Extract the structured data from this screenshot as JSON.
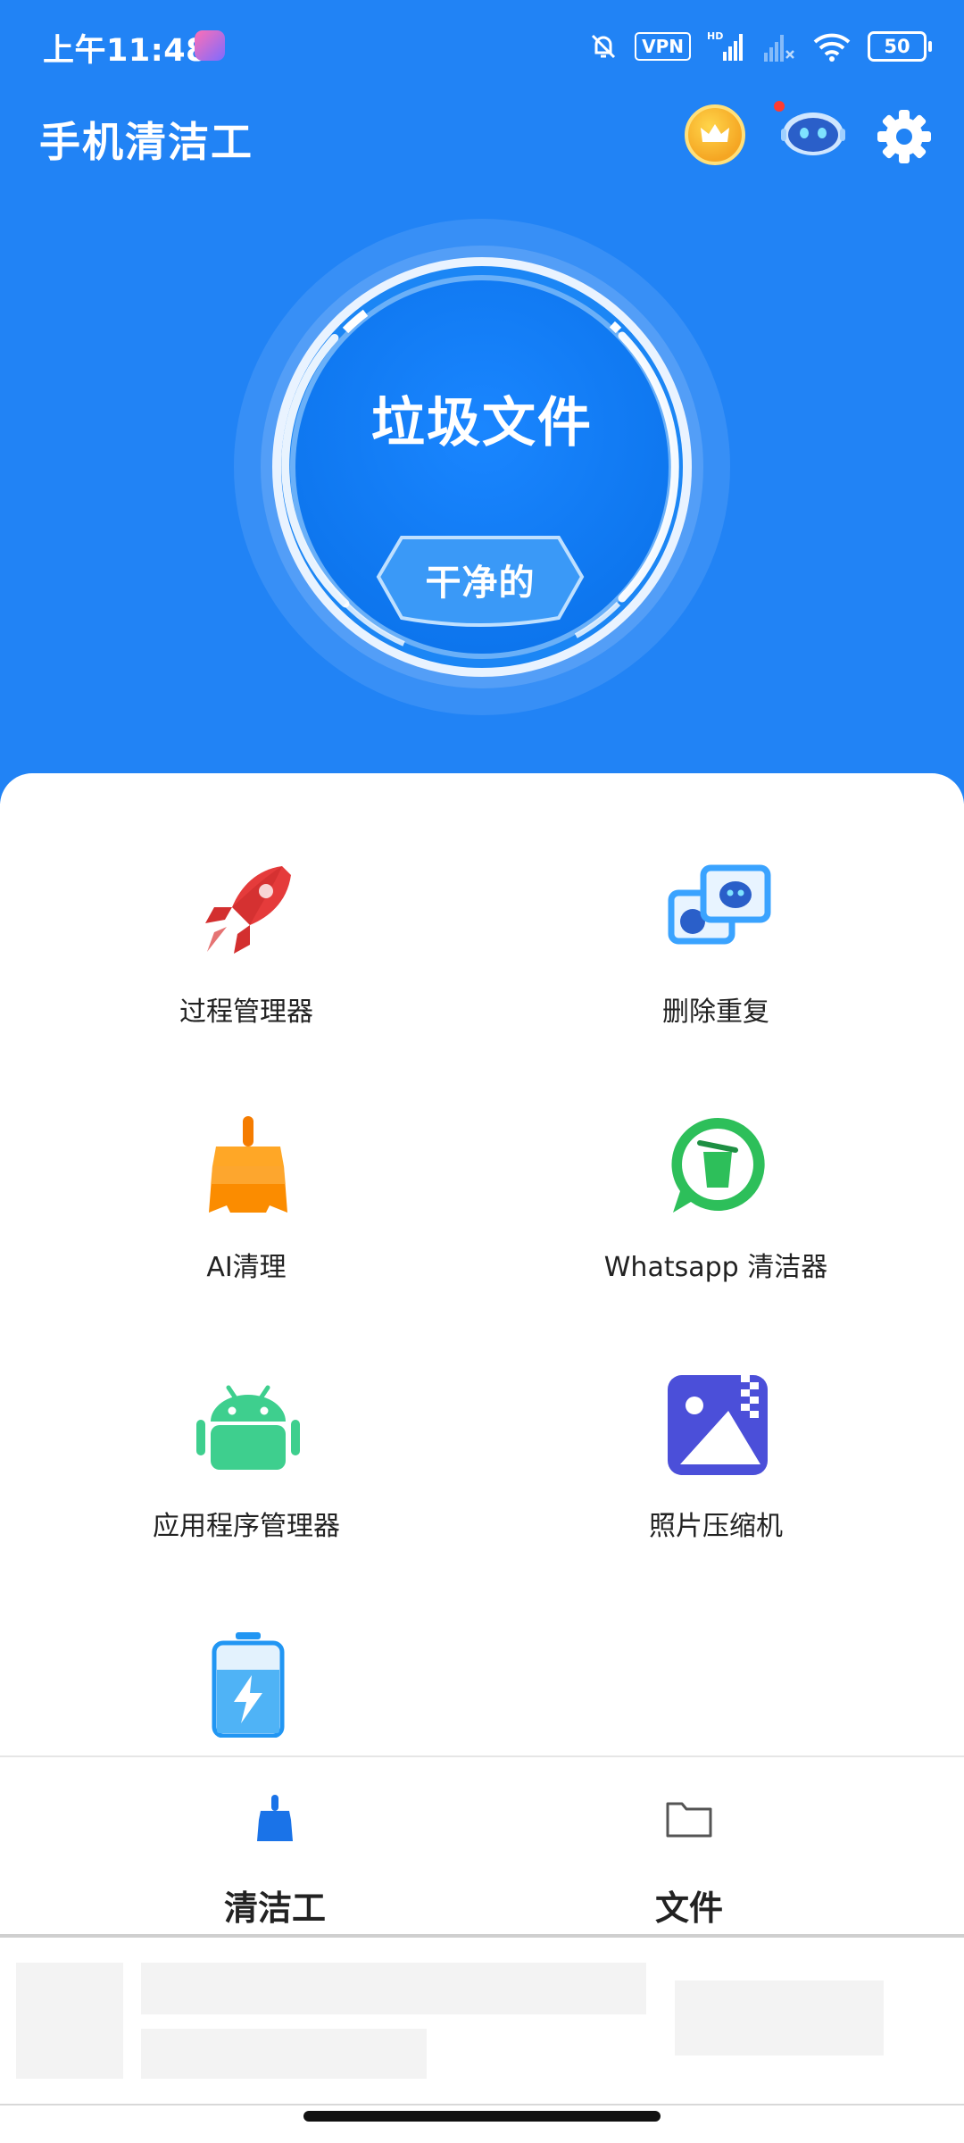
{
  "status_bar": {
    "time": "上午11:48",
    "vpn": "VPN",
    "hd": "HD",
    "battery": "50"
  },
  "header": {
    "title": "手机清洁工"
  },
  "gauge": {
    "title": "垃圾文件",
    "status": "干净的"
  },
  "tools": [
    {
      "label": "过程管理器",
      "icon": "rocket-icon"
    },
    {
      "label": "删除重复",
      "icon": "duplicate-photos-icon"
    },
    {
      "label": "AI清理",
      "icon": "broom-icon"
    },
    {
      "label": "Whatsapp 清洁器",
      "icon": "whatsapp-trash-icon"
    },
    {
      "label": "应用程序管理器",
      "icon": "android-icon"
    },
    {
      "label": "照片压缩机",
      "icon": "photo-zip-icon"
    },
    {
      "label": "",
      "icon": "battery-bolt-icon"
    }
  ],
  "bottom_nav": {
    "items": [
      {
        "label": "清洁工",
        "icon": "broom-icon"
      },
      {
        "label": "文件",
        "icon": "folder-icon"
      }
    ]
  },
  "colors": {
    "primary_blue": "#2183f5",
    "accent_blue": "#1a73e8"
  }
}
